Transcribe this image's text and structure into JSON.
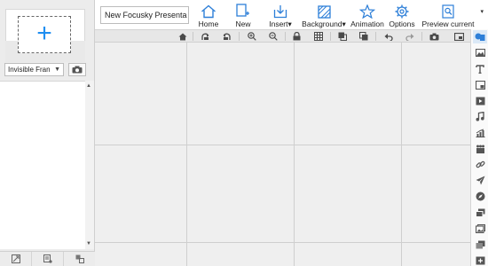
{
  "left_panel": {
    "add_frame_symbol": "+",
    "frame_select": {
      "value": "Invisible Fran",
      "arrow": "▼"
    },
    "scroll": {
      "up": "▲",
      "down": "▼"
    }
  },
  "ribbon": {
    "title_value": "New Focusky Presenta",
    "buttons": [
      {
        "label": "Home"
      },
      {
        "label": "New"
      },
      {
        "label": "Insert▾"
      },
      {
        "label": "Background▾"
      },
      {
        "label": "Animation"
      },
      {
        "label": "Options"
      },
      {
        "label": "Preview current"
      }
    ],
    "collapse": "▾"
  },
  "colors": {
    "accent": "#1f8ef1",
    "icon_blue": "#2d7fd8",
    "toolbar_icon": "#4a4a4a",
    "canvas_bg": "#efefef",
    "grid": "#cfcfcf"
  }
}
